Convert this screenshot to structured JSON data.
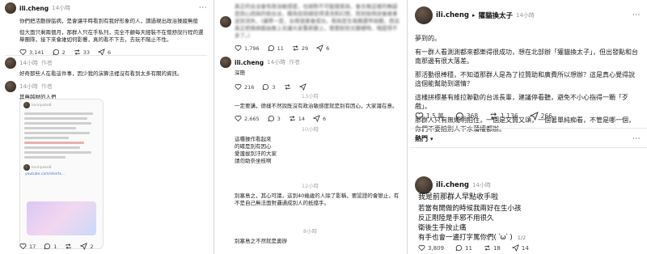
{
  "col1": {
    "post1": {
      "user": "ili.cheng",
      "time": "14小時",
      "text1": "你們把活動辦詬病，是會讓平時看到有我好形象的人，讀過現出政治操縱無般",
      "text2": "但大面只剩兩個月，那群人只在手私刊，完全不顧每天經裝不在懷舒說行程的選舉團隊，接下來會維如何影響，真的看不下去，去玩不階止不性。",
      "likes": "3,141",
      "comments": "2",
      "reposts": "33",
      "shares": "6"
    },
    "post2": {
      "time": "14小時",
      "tag": "作者",
      "text": "好奇那些人在看這件事，因少我的演算法裡沒有看到太多有關的資訊。"
    },
    "post3": {
      "time": "14小時",
      "tag": "作者",
      "text": "其無越財的人們",
      "screenshot_user": "lovinpoke8",
      "screenshot_link": "youtube.com/shorts...",
      "likes": "17",
      "comments": "1",
      "shares": "2"
    }
  },
  "col2": {
    "post1": {
      "text": "真正的台派會有政治敏感度，也絕對不可能隨意與，會去做這樣的無疑是因心因與的假台派，關為從結總從得清洗和幻想，而到指快說會維拿送到消失，(讓帶一是，台南號黃會成功，南與是生角關選甲與關，西且真正把佛病都由推上去讓大家重新變上，需要耐到文變硬時，哦提得不多了。)",
      "likes": "1,796",
      "comments": "11",
      "reposts": "29",
      "shares": "6"
    },
    "post2": {
      "user": "ili.cheng",
      "time": "14小時",
      "tag": "作者",
      "text": "深簡",
      "likes": "216",
      "comments": "3"
    },
    "post3": {
      "time": "13小時",
      "text": "一定要講，德樣不然說既沒有政治敏感度就是別有因心，大家識在意。",
      "likes": "2,665",
      "comments": "3",
      "reposts": "14",
      "shares": "6"
    },
    "post4": {
      "time": "10小時",
      "lines": [
        "這種操作看起來",
        "的確是別有因心",
        "愛護拔別汙的大家",
        "請勿助奈坐枝啊"
      ]
    },
    "post5": {
      "time": "12小時",
      "text": "別塞島之，其心可議，這到40幾歲的人除了影稱，要認證的會戀止，有不是自己無法面對邏通成別人的抵擋手。"
    },
    "post6": {
      "time": "8小時",
      "text": "別塞島之不然就是奧辦"
    }
  },
  "col3": {
    "header": {
      "user": "ili.cheng",
      "arrow": "▸",
      "reply_to": "獾貓換太子",
      "time": "14小時",
      "more": "···"
    },
    "paras": [
      "夢到的。",
      "有一群人看測測都來都樂得很成功，想在北部辦「獾貓換太子」，但出發點和台南那邊有很大落差。",
      "那活動很棒穩，不知道那群人是為了拉贊助和廣費所以想辦？這是真心覺得說這個能幫助到選情？",
      "這樣拼標基有維拉聯勸的台派長輩，建議停看聽，避免不小心指得一顆「歹戲」。",
      "那群人只有無燭明拍住，一個是又贊又頌，一個著單純痴看，不管是哪一個，你們不要拍別人下水蒲權都辦。"
    ],
    "stats": {
      "likes": "1.5 萬",
      "comments": "368",
      "reposts": "1,136",
      "shares": "266"
    },
    "sort": {
      "label": "熱門",
      "more": "···"
    },
    "reply": {
      "user": "ili.cheng",
      "time": "14小時",
      "intro": "我是前那群人早點收手啦",
      "lines": [
        "若當有開做的時候我兩好在生小孩",
        "反正剛陸是手邪不用很久",
        "衛後生手按止痛",
        "有手也會一邊打字罵你們( ՝ω՝ )"
      ],
      "page": "1/2",
      "likes": "3,809",
      "comments": "11",
      "reposts": "18",
      "shares": "14"
    }
  }
}
